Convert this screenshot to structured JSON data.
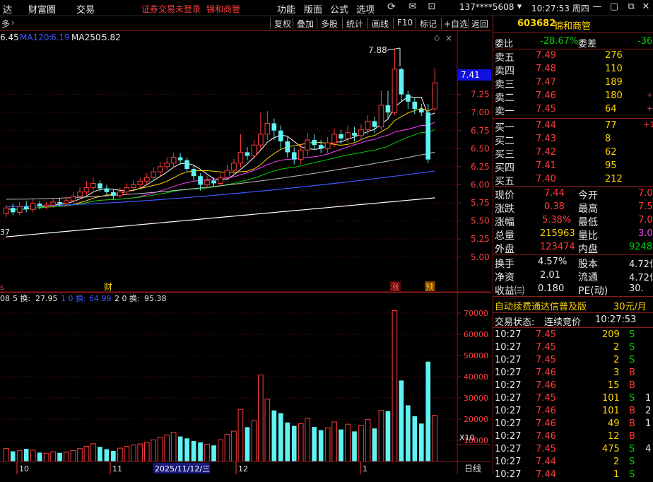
{
  "menubar": {
    "items": [
      "达",
      "财富圈",
      "交易"
    ],
    "warning": "证券交易未登录",
    "stock_name": "锦和商管",
    "right_items": [
      "功能",
      "版面",
      "公式",
      "选项"
    ],
    "account": "137****5608",
    "clock": "10:27:53 周四"
  },
  "toolbar": {
    "left_label": "多",
    "buttons": [
      "复权",
      "叠加",
      "多股",
      "统计",
      "画线",
      "F10",
      "标记",
      "+自选",
      "返回"
    ]
  },
  "ma_legend": {
    "ma60": "6.45",
    "ma120_label": "MA120:",
    "ma120": "6.19",
    "ma250_label": "MA250:",
    "ma250": "5.82"
  },
  "price_axis": {
    "current": "7.41",
    "ticks": [
      "7.25",
      "7.00",
      "6.75",
      "6.50",
      "6.25",
      "6.00",
      "5.75",
      "5.50",
      "5.25",
      "5.00"
    ]
  },
  "annotations": {
    "high_label": "7.88",
    "low_label": "37",
    "left_marker": "s",
    "cai_marker": "财",
    "zhang_marker": "涨",
    "yu_marker": "预"
  },
  "volume_legend": {
    "prefix": "08",
    "ma5_label": "5 换:",
    "ma5": "27.95",
    "ma10_label": "1 0 换:",
    "ma10": "64.99",
    "ma20_label": "2 0 换:",
    "ma20": "95.38"
  },
  "volume_axis": {
    "ticks": [
      "70000",
      "60000",
      "50000",
      "40000",
      "30000",
      "20000",
      "10000"
    ],
    "unit": "X10"
  },
  "date_axis": {
    "labels": [
      "10",
      "11",
      "2025/11/12/三",
      "12",
      "1"
    ],
    "period": "日线"
  },
  "chart_data": {
    "type": "candlestick",
    "price_range": [
      4.9,
      7.95
    ],
    "volume_range": [
      0,
      75000
    ],
    "candles": [
      {
        "o": 5.6,
        "c": 5.68,
        "h": 5.72,
        "l": 5.55,
        "v": 6200
      },
      {
        "o": 5.68,
        "c": 5.62,
        "h": 5.74,
        "l": 5.58,
        "v": 4800
      },
      {
        "o": 5.62,
        "c": 5.7,
        "h": 5.76,
        "l": 5.58,
        "v": 5100
      },
      {
        "o": 5.7,
        "c": 5.66,
        "h": 5.78,
        "l": 5.62,
        "v": 6000
      },
      {
        "o": 5.66,
        "c": 5.74,
        "h": 5.8,
        "l": 5.62,
        "v": 5400
      },
      {
        "o": 5.74,
        "c": 5.7,
        "h": 5.78,
        "l": 5.66,
        "v": 4200
      },
      {
        "o": 5.7,
        "c": 5.72,
        "h": 5.76,
        "l": 5.66,
        "v": 3900
      },
      {
        "o": 5.72,
        "c": 5.76,
        "h": 5.82,
        "l": 5.68,
        "v": 4600
      },
      {
        "o": 5.76,
        "c": 5.74,
        "h": 5.82,
        "l": 5.7,
        "v": 4100
      },
      {
        "o": 5.74,
        "c": 5.78,
        "h": 5.84,
        "l": 5.7,
        "v": 4400
      },
      {
        "o": 5.78,
        "c": 5.84,
        "h": 5.9,
        "l": 5.74,
        "v": 5200
      },
      {
        "o": 5.84,
        "c": 5.9,
        "h": 5.96,
        "l": 5.8,
        "v": 6100
      },
      {
        "o": 5.9,
        "c": 5.96,
        "h": 6.05,
        "l": 5.86,
        "v": 7200
      },
      {
        "o": 5.96,
        "c": 6.02,
        "h": 6.1,
        "l": 5.92,
        "v": 8400
      },
      {
        "o": 6.02,
        "c": 5.95,
        "h": 6.06,
        "l": 5.9,
        "v": 6900
      },
      {
        "o": 5.95,
        "c": 5.9,
        "h": 6.0,
        "l": 5.86,
        "v": 5800
      },
      {
        "o": 5.9,
        "c": 5.85,
        "h": 5.94,
        "l": 5.8,
        "v": 5000
      },
      {
        "o": 5.85,
        "c": 5.9,
        "h": 5.96,
        "l": 5.82,
        "v": 6300
      },
      {
        "o": 5.9,
        "c": 5.96,
        "h": 6.02,
        "l": 5.86,
        "v": 7100
      },
      {
        "o": 5.96,
        "c": 6.0,
        "h": 6.06,
        "l": 5.92,
        "v": 7800
      },
      {
        "o": 6.0,
        "c": 6.05,
        "h": 6.1,
        "l": 5.96,
        "v": 8300
      },
      {
        "o": 6.05,
        "c": 6.1,
        "h": 6.16,
        "l": 6.0,
        "v": 9100
      },
      {
        "o": 6.1,
        "c": 6.18,
        "h": 6.24,
        "l": 6.06,
        "v": 10200
      },
      {
        "o": 6.18,
        "c": 6.25,
        "h": 6.32,
        "l": 6.12,
        "v": 11400
      },
      {
        "o": 6.25,
        "c": 6.3,
        "h": 6.38,
        "l": 6.2,
        "v": 12500
      },
      {
        "o": 6.3,
        "c": 6.38,
        "h": 6.44,
        "l": 6.24,
        "v": 13800
      },
      {
        "o": 6.38,
        "c": 6.34,
        "h": 6.44,
        "l": 6.28,
        "v": 11800
      },
      {
        "o": 6.34,
        "c": 6.22,
        "h": 6.38,
        "l": 6.18,
        "v": 10900
      },
      {
        "o": 6.22,
        "c": 6.12,
        "h": 6.28,
        "l": 6.06,
        "v": 9700
      },
      {
        "o": 6.12,
        "c": 6.0,
        "h": 6.16,
        "l": 5.92,
        "v": 9000
      },
      {
        "o": 6.0,
        "c": 6.06,
        "h": 6.12,
        "l": 5.96,
        "v": 8200
      },
      {
        "o": 6.06,
        "c": 6.02,
        "h": 6.1,
        "l": 5.98,
        "v": 7600
      },
      {
        "o": 6.02,
        "c": 6.1,
        "h": 6.16,
        "l": 5.98,
        "v": 10300
      },
      {
        "o": 6.1,
        "c": 6.2,
        "h": 6.28,
        "l": 6.06,
        "v": 12800
      },
      {
        "o": 6.2,
        "c": 6.3,
        "h": 6.36,
        "l": 6.15,
        "v": 14300
      },
      {
        "o": 6.3,
        "c": 6.45,
        "h": 6.7,
        "l": 6.24,
        "v": 24600
      },
      {
        "o": 6.45,
        "c": 6.4,
        "h": 6.52,
        "l": 6.34,
        "v": 16200
      },
      {
        "o": 6.4,
        "c": 6.55,
        "h": 6.62,
        "l": 6.36,
        "v": 19200
      },
      {
        "o": 6.55,
        "c": 6.7,
        "h": 7.0,
        "l": 6.48,
        "v": 40800
      },
      {
        "o": 6.7,
        "c": 6.85,
        "h": 7.02,
        "l": 6.62,
        "v": 29400
      },
      {
        "o": 6.85,
        "c": 6.75,
        "h": 6.92,
        "l": 6.62,
        "v": 24100
      },
      {
        "o": 6.75,
        "c": 6.6,
        "h": 6.82,
        "l": 6.5,
        "v": 22800
      },
      {
        "o": 6.6,
        "c": 6.45,
        "h": 6.66,
        "l": 6.38,
        "v": 18400
      },
      {
        "o": 6.45,
        "c": 6.35,
        "h": 6.52,
        "l": 6.28,
        "v": 16800
      },
      {
        "o": 6.35,
        "c": 6.48,
        "h": 6.56,
        "l": 6.28,
        "v": 17900
      },
      {
        "o": 6.48,
        "c": 6.62,
        "h": 6.72,
        "l": 6.4,
        "v": 20400
      },
      {
        "o": 6.62,
        "c": 6.55,
        "h": 6.7,
        "l": 6.48,
        "v": 16300
      },
      {
        "o": 6.55,
        "c": 6.5,
        "h": 6.62,
        "l": 6.44,
        "v": 14800
      },
      {
        "o": 6.5,
        "c": 6.58,
        "h": 6.66,
        "l": 6.44,
        "v": 15900
      },
      {
        "o": 6.58,
        "c": 6.7,
        "h": 6.78,
        "l": 6.52,
        "v": 18700
      },
      {
        "o": 6.7,
        "c": 6.64,
        "h": 6.76,
        "l": 6.56,
        "v": 15100
      },
      {
        "o": 6.64,
        "c": 6.72,
        "h": 6.82,
        "l": 6.58,
        "v": 17600
      },
      {
        "o": 6.72,
        "c": 6.68,
        "h": 6.8,
        "l": 6.6,
        "v": 14200
      },
      {
        "o": 6.68,
        "c": 6.76,
        "h": 6.84,
        "l": 6.62,
        "v": 16900
      },
      {
        "o": 6.76,
        "c": 6.88,
        "h": 6.96,
        "l": 6.7,
        "v": 19800
      },
      {
        "o": 6.88,
        "c": 6.8,
        "h": 6.94,
        "l": 6.72,
        "v": 15600
      },
      {
        "o": 6.8,
        "c": 7.1,
        "h": 7.3,
        "l": 6.76,
        "v": 24100
      },
      {
        "o": 7.1,
        "c": 7.0,
        "h": 7.3,
        "l": 6.92,
        "v": 23800
      },
      {
        "o": 7.0,
        "c": 7.6,
        "h": 7.88,
        "l": 6.96,
        "v": 71200
      },
      {
        "o": 7.6,
        "c": 7.25,
        "h": 7.62,
        "l": 7.15,
        "v": 38200
      },
      {
        "o": 7.25,
        "c": 7.15,
        "h": 7.3,
        "l": 7.05,
        "v": 26500
      },
      {
        "o": 7.15,
        "c": 7.05,
        "h": 7.2,
        "l": 6.98,
        "v": 21400
      },
      {
        "o": 7.05,
        "c": 7.0,
        "h": 7.12,
        "l": 6.95,
        "v": 17900
      },
      {
        "o": 7.0,
        "c": 6.35,
        "h": 7.12,
        "l": 6.3,
        "v": 47100
      },
      {
        "o": 7.05,
        "c": 7.41,
        "h": 7.62,
        "l": 7.02,
        "v": 21800
      }
    ]
  },
  "right_panel": {
    "code": "603682",
    "name": "锦和商管",
    "ratio_label": "委比",
    "ratio": "-28.67%",
    "diff_label": "委差",
    "diff": "-36",
    "asks": [
      {
        "label": "卖五",
        "price": "7.49",
        "vol": "276"
      },
      {
        "label": "卖四",
        "price": "7.48",
        "vol": "110"
      },
      {
        "label": "卖三",
        "price": "7.47",
        "vol": "189"
      },
      {
        "label": "卖二",
        "price": "7.46",
        "vol": "180",
        "chg": "+"
      },
      {
        "label": "卖一",
        "price": "7.45",
        "vol": "64",
        "chg": "+"
      }
    ],
    "bids": [
      {
        "label": "买一",
        "price": "7.44",
        "vol": "77",
        "chg": "+1"
      },
      {
        "label": "买二",
        "price": "7.43",
        "vol": "8"
      },
      {
        "label": "买三",
        "price": "7.42",
        "vol": "62"
      },
      {
        "label": "买四",
        "price": "7.41",
        "vol": "95"
      },
      {
        "label": "买五",
        "price": "7.40",
        "vol": "212"
      }
    ],
    "stats": [
      {
        "l1": "现价",
        "v1": "7.44",
        "c1": "red",
        "l2": "今开",
        "v2": "7.0",
        "c2": "red"
      },
      {
        "l1": "涨跌",
        "v1": "0.38",
        "c1": "red",
        "l2": "最高",
        "v2": "7.5",
        "c2": "red"
      },
      {
        "l1": "涨幅",
        "v1": "5.38%",
        "c1": "red",
        "l2": "最低",
        "v2": "7.0",
        "c2": "red"
      },
      {
        "l1": "总量",
        "v1": "215963",
        "c1": "yellow",
        "l2": "量比",
        "v2": "3.0",
        "c2": "purple"
      },
      {
        "l1": "外盘",
        "v1": "123474",
        "c1": "red",
        "l2": "内盘",
        "v2": "9248",
        "c2": "green"
      }
    ],
    "stats2": [
      {
        "l1": "换手",
        "v1": "4.57%",
        "l2": "股本",
        "v2": "4.72亿"
      },
      {
        "l1": "净资",
        "v1": "2.01",
        "l2": "流通",
        "v2": "4.72亿"
      },
      {
        "l1": "收益㈢",
        "v1": "0.180",
        "l2": "PE(动)",
        "v2": "30."
      }
    ],
    "promo": "自动续费通达信普及版",
    "promo_price": "30元/月",
    "trade_status_label": "交易状态:",
    "trade_status": "连续竞价",
    "trade_time": "10:27:53",
    "ticks": [
      {
        "t": "10:27",
        "p": "7.45",
        "v": "209",
        "s": "S",
        "n": ""
      },
      {
        "t": "10:27",
        "p": "7.45",
        "v": "2",
        "s": "S",
        "n": ""
      },
      {
        "t": "10:27",
        "p": "7.45",
        "v": "2",
        "s": "S",
        "n": ""
      },
      {
        "t": "10:27",
        "p": "7.46",
        "v": "3",
        "s": "B",
        "n": ""
      },
      {
        "t": "10:27",
        "p": "7.46",
        "v": "15",
        "s": "B",
        "n": ""
      },
      {
        "t": "10:27",
        "p": "7.45",
        "v": "101",
        "s": "S",
        "n": "1"
      },
      {
        "t": "10:27",
        "p": "7.46",
        "v": "101",
        "s": "B",
        "n": "2"
      },
      {
        "t": "10:27",
        "p": "7.46",
        "v": "49",
        "s": "B",
        "n": "1"
      },
      {
        "t": "10:27",
        "p": "7.46",
        "v": "12",
        "s": "B",
        "n": ""
      },
      {
        "t": "10:27",
        "p": "7.45",
        "v": "475",
        "s": "S",
        "n": "4"
      },
      {
        "t": "10:27",
        "p": "7.44",
        "v": "2",
        "s": "S",
        "n": ""
      },
      {
        "t": "10:27",
        "p": "7.44",
        "v": "1",
        "s": "S",
        "n": ""
      }
    ]
  }
}
